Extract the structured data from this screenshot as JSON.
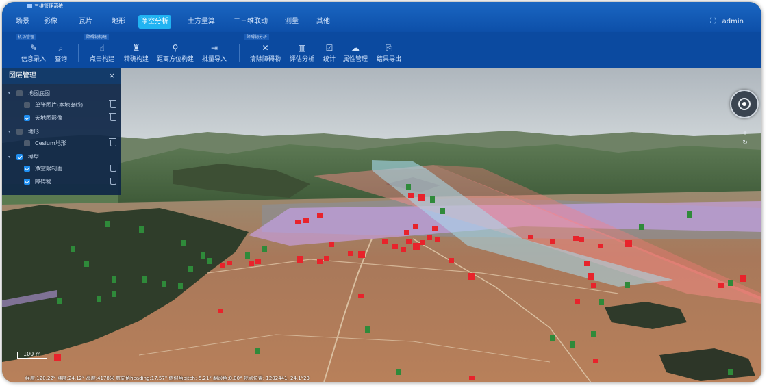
{
  "app": {
    "title": "三维管理系统"
  },
  "menu": {
    "items": [
      {
        "label": "场景"
      },
      {
        "label": "影像"
      },
      {
        "label": "瓦片"
      },
      {
        "label": "地形"
      },
      {
        "label": "净空分析"
      },
      {
        "label": "土方量算"
      },
      {
        "label": "二三维联动"
      },
      {
        "label": "测量"
      },
      {
        "label": "其他"
      }
    ],
    "active_index": 4
  },
  "user": {
    "name": "admin",
    "fullscreen_icon": "fullscreen-icon"
  },
  "toolbar": {
    "groups": [
      {
        "label": "机场管理"
      },
      {
        "label": "障碍物构建"
      },
      {
        "label": "障碍物分析"
      }
    ],
    "tools": [
      {
        "label": "信息录入",
        "icon": "edit-icon",
        "glyph": "✎"
      },
      {
        "label": "查询",
        "icon": "search-icon",
        "glyph": "⌕"
      },
      {
        "label": "点击构建",
        "icon": "click-icon",
        "glyph": "☝"
      },
      {
        "label": "精确构建",
        "icon": "build-icon",
        "glyph": "♜"
      },
      {
        "label": "距离方位构建",
        "icon": "compass-build-icon",
        "glyph": "⚲"
      },
      {
        "label": "批量导入",
        "icon": "import-icon",
        "glyph": "⇥"
      },
      {
        "label": "清除障碍物",
        "icon": "clear-icon",
        "glyph": "✕"
      },
      {
        "label": "评估分析",
        "icon": "analysis-icon",
        "glyph": "▥"
      },
      {
        "label": "统计",
        "icon": "statistics-icon",
        "glyph": "☑"
      },
      {
        "label": "属性管理",
        "icon": "attribute-icon",
        "glyph": "☁"
      },
      {
        "label": "结果导出",
        "icon": "export-icon",
        "glyph": "⎘"
      }
    ]
  },
  "layer_panel": {
    "title": "图层管理",
    "close_glyph": "×",
    "rows": [
      {
        "label": "地图底图",
        "checked": false,
        "level": 0
      },
      {
        "label": "单张图片(本地离线)",
        "checked": false,
        "level": 1
      },
      {
        "label": "天地图影像",
        "checked": true,
        "level": 1
      },
      {
        "label": "地形",
        "checked": false,
        "level": 0
      },
      {
        "label": "Cesium地形",
        "checked": false,
        "level": 1
      },
      {
        "label": "模型",
        "checked": true,
        "level": 0
      },
      {
        "label": "净空限制面",
        "checked": true,
        "level": 1
      },
      {
        "label": "障碍物",
        "checked": true,
        "level": 1
      }
    ]
  },
  "map_controls": {
    "zoom_in": "+",
    "zoom_out": "−"
  },
  "scale": {
    "label": "100 m"
  },
  "status_bar": {
    "text": "经度:120.22° 纬度:24.12° 高度:4178米 航向角heading:17.57° 俯仰角pitch:-5.21° 翻滚角:0.00° 视点位置: 1202441, 24.1°23"
  },
  "colors": {
    "header": "#1a66c2",
    "toolbar": "#0b4aa0",
    "active_tab": "#21b3f2",
    "obstacle_red": "#e8232b",
    "obstacle_green": "#2f8a3a",
    "approach_surface": "#ff8b8b",
    "transition_surface": "#cfa8ff",
    "inner_surface": "#a8dcef"
  }
}
